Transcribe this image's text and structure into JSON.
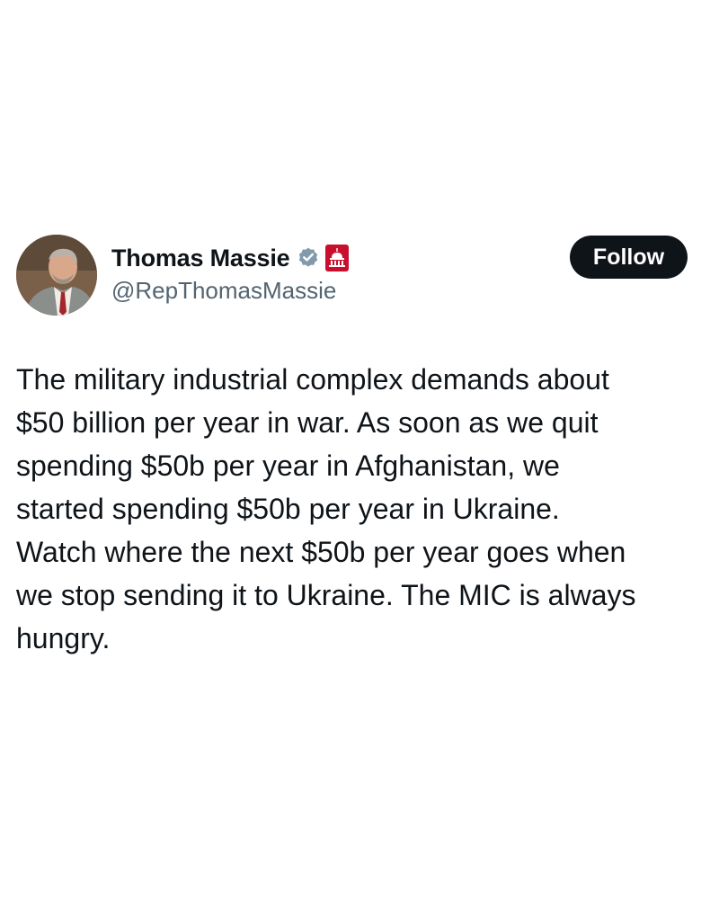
{
  "author": {
    "display_name": "Thomas Massie",
    "handle": "@RepThomasMassie",
    "avatar": "profile-photo",
    "badges": [
      "verified-check-icon",
      "us-capitol-affiliation-icon"
    ]
  },
  "actions": {
    "follow_label": "Follow"
  },
  "tweet": {
    "lines": [
      "The military industrial complex demands about",
      "$50 billion per year in war. As soon as we quit",
      "spending $50b per year in Afghanistan, we",
      "started spending $50b per year in Ukraine.",
      "Watch where the next $50b per year goes when",
      "we stop sending it to Ukraine. The MIC is always",
      "hungry."
    ]
  },
  "colors": {
    "text_primary": "#0f1419",
    "text_secondary": "#536471",
    "button_bg": "#0f1419",
    "button_text": "#ffffff",
    "verified_badge": "#829aab",
    "affiliation_badge": "#c8102e"
  }
}
